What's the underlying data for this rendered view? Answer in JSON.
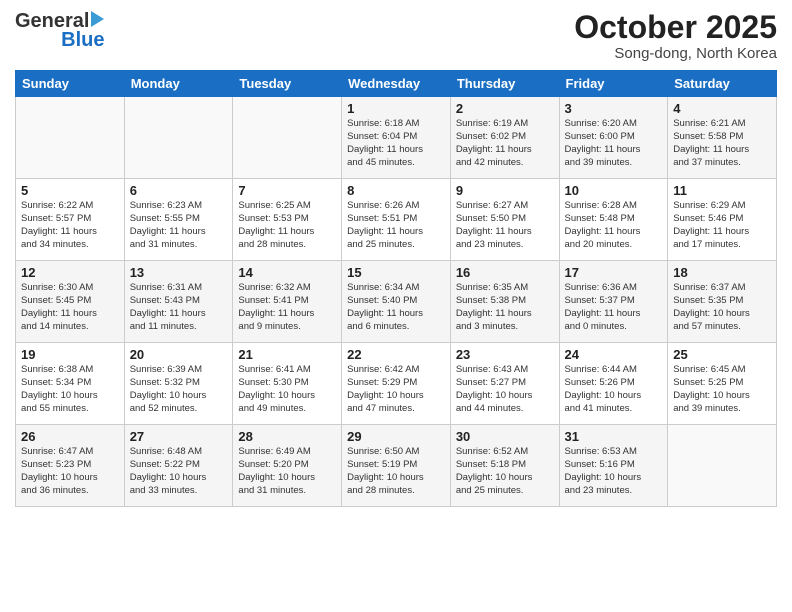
{
  "header": {
    "logo_general": "General",
    "logo_blue": "Blue",
    "month_title": "October 2025",
    "location": "Song-dong, North Korea"
  },
  "days_of_week": [
    "Sunday",
    "Monday",
    "Tuesday",
    "Wednesday",
    "Thursday",
    "Friday",
    "Saturday"
  ],
  "weeks": [
    [
      {
        "day": "",
        "info": ""
      },
      {
        "day": "",
        "info": ""
      },
      {
        "day": "",
        "info": ""
      },
      {
        "day": "1",
        "info": "Sunrise: 6:18 AM\nSunset: 6:04 PM\nDaylight: 11 hours\nand 45 minutes."
      },
      {
        "day": "2",
        "info": "Sunrise: 6:19 AM\nSunset: 6:02 PM\nDaylight: 11 hours\nand 42 minutes."
      },
      {
        "day": "3",
        "info": "Sunrise: 6:20 AM\nSunset: 6:00 PM\nDaylight: 11 hours\nand 39 minutes."
      },
      {
        "day": "4",
        "info": "Sunrise: 6:21 AM\nSunset: 5:58 PM\nDaylight: 11 hours\nand 37 minutes."
      }
    ],
    [
      {
        "day": "5",
        "info": "Sunrise: 6:22 AM\nSunset: 5:57 PM\nDaylight: 11 hours\nand 34 minutes."
      },
      {
        "day": "6",
        "info": "Sunrise: 6:23 AM\nSunset: 5:55 PM\nDaylight: 11 hours\nand 31 minutes."
      },
      {
        "day": "7",
        "info": "Sunrise: 6:25 AM\nSunset: 5:53 PM\nDaylight: 11 hours\nand 28 minutes."
      },
      {
        "day": "8",
        "info": "Sunrise: 6:26 AM\nSunset: 5:51 PM\nDaylight: 11 hours\nand 25 minutes."
      },
      {
        "day": "9",
        "info": "Sunrise: 6:27 AM\nSunset: 5:50 PM\nDaylight: 11 hours\nand 23 minutes."
      },
      {
        "day": "10",
        "info": "Sunrise: 6:28 AM\nSunset: 5:48 PM\nDaylight: 11 hours\nand 20 minutes."
      },
      {
        "day": "11",
        "info": "Sunrise: 6:29 AM\nSunset: 5:46 PM\nDaylight: 11 hours\nand 17 minutes."
      }
    ],
    [
      {
        "day": "12",
        "info": "Sunrise: 6:30 AM\nSunset: 5:45 PM\nDaylight: 11 hours\nand 14 minutes."
      },
      {
        "day": "13",
        "info": "Sunrise: 6:31 AM\nSunset: 5:43 PM\nDaylight: 11 hours\nand 11 minutes."
      },
      {
        "day": "14",
        "info": "Sunrise: 6:32 AM\nSunset: 5:41 PM\nDaylight: 11 hours\nand 9 minutes."
      },
      {
        "day": "15",
        "info": "Sunrise: 6:34 AM\nSunset: 5:40 PM\nDaylight: 11 hours\nand 6 minutes."
      },
      {
        "day": "16",
        "info": "Sunrise: 6:35 AM\nSunset: 5:38 PM\nDaylight: 11 hours\nand 3 minutes."
      },
      {
        "day": "17",
        "info": "Sunrise: 6:36 AM\nSunset: 5:37 PM\nDaylight: 11 hours\nand 0 minutes."
      },
      {
        "day": "18",
        "info": "Sunrise: 6:37 AM\nSunset: 5:35 PM\nDaylight: 10 hours\nand 57 minutes."
      }
    ],
    [
      {
        "day": "19",
        "info": "Sunrise: 6:38 AM\nSunset: 5:34 PM\nDaylight: 10 hours\nand 55 minutes."
      },
      {
        "day": "20",
        "info": "Sunrise: 6:39 AM\nSunset: 5:32 PM\nDaylight: 10 hours\nand 52 minutes."
      },
      {
        "day": "21",
        "info": "Sunrise: 6:41 AM\nSunset: 5:30 PM\nDaylight: 10 hours\nand 49 minutes."
      },
      {
        "day": "22",
        "info": "Sunrise: 6:42 AM\nSunset: 5:29 PM\nDaylight: 10 hours\nand 47 minutes."
      },
      {
        "day": "23",
        "info": "Sunrise: 6:43 AM\nSunset: 5:27 PM\nDaylight: 10 hours\nand 44 minutes."
      },
      {
        "day": "24",
        "info": "Sunrise: 6:44 AM\nSunset: 5:26 PM\nDaylight: 10 hours\nand 41 minutes."
      },
      {
        "day": "25",
        "info": "Sunrise: 6:45 AM\nSunset: 5:25 PM\nDaylight: 10 hours\nand 39 minutes."
      }
    ],
    [
      {
        "day": "26",
        "info": "Sunrise: 6:47 AM\nSunset: 5:23 PM\nDaylight: 10 hours\nand 36 minutes."
      },
      {
        "day": "27",
        "info": "Sunrise: 6:48 AM\nSunset: 5:22 PM\nDaylight: 10 hours\nand 33 minutes."
      },
      {
        "day": "28",
        "info": "Sunrise: 6:49 AM\nSunset: 5:20 PM\nDaylight: 10 hours\nand 31 minutes."
      },
      {
        "day": "29",
        "info": "Sunrise: 6:50 AM\nSunset: 5:19 PM\nDaylight: 10 hours\nand 28 minutes."
      },
      {
        "day": "30",
        "info": "Sunrise: 6:52 AM\nSunset: 5:18 PM\nDaylight: 10 hours\nand 25 minutes."
      },
      {
        "day": "31",
        "info": "Sunrise: 6:53 AM\nSunset: 5:16 PM\nDaylight: 10 hours\nand 23 minutes."
      },
      {
        "day": "",
        "info": ""
      }
    ]
  ]
}
